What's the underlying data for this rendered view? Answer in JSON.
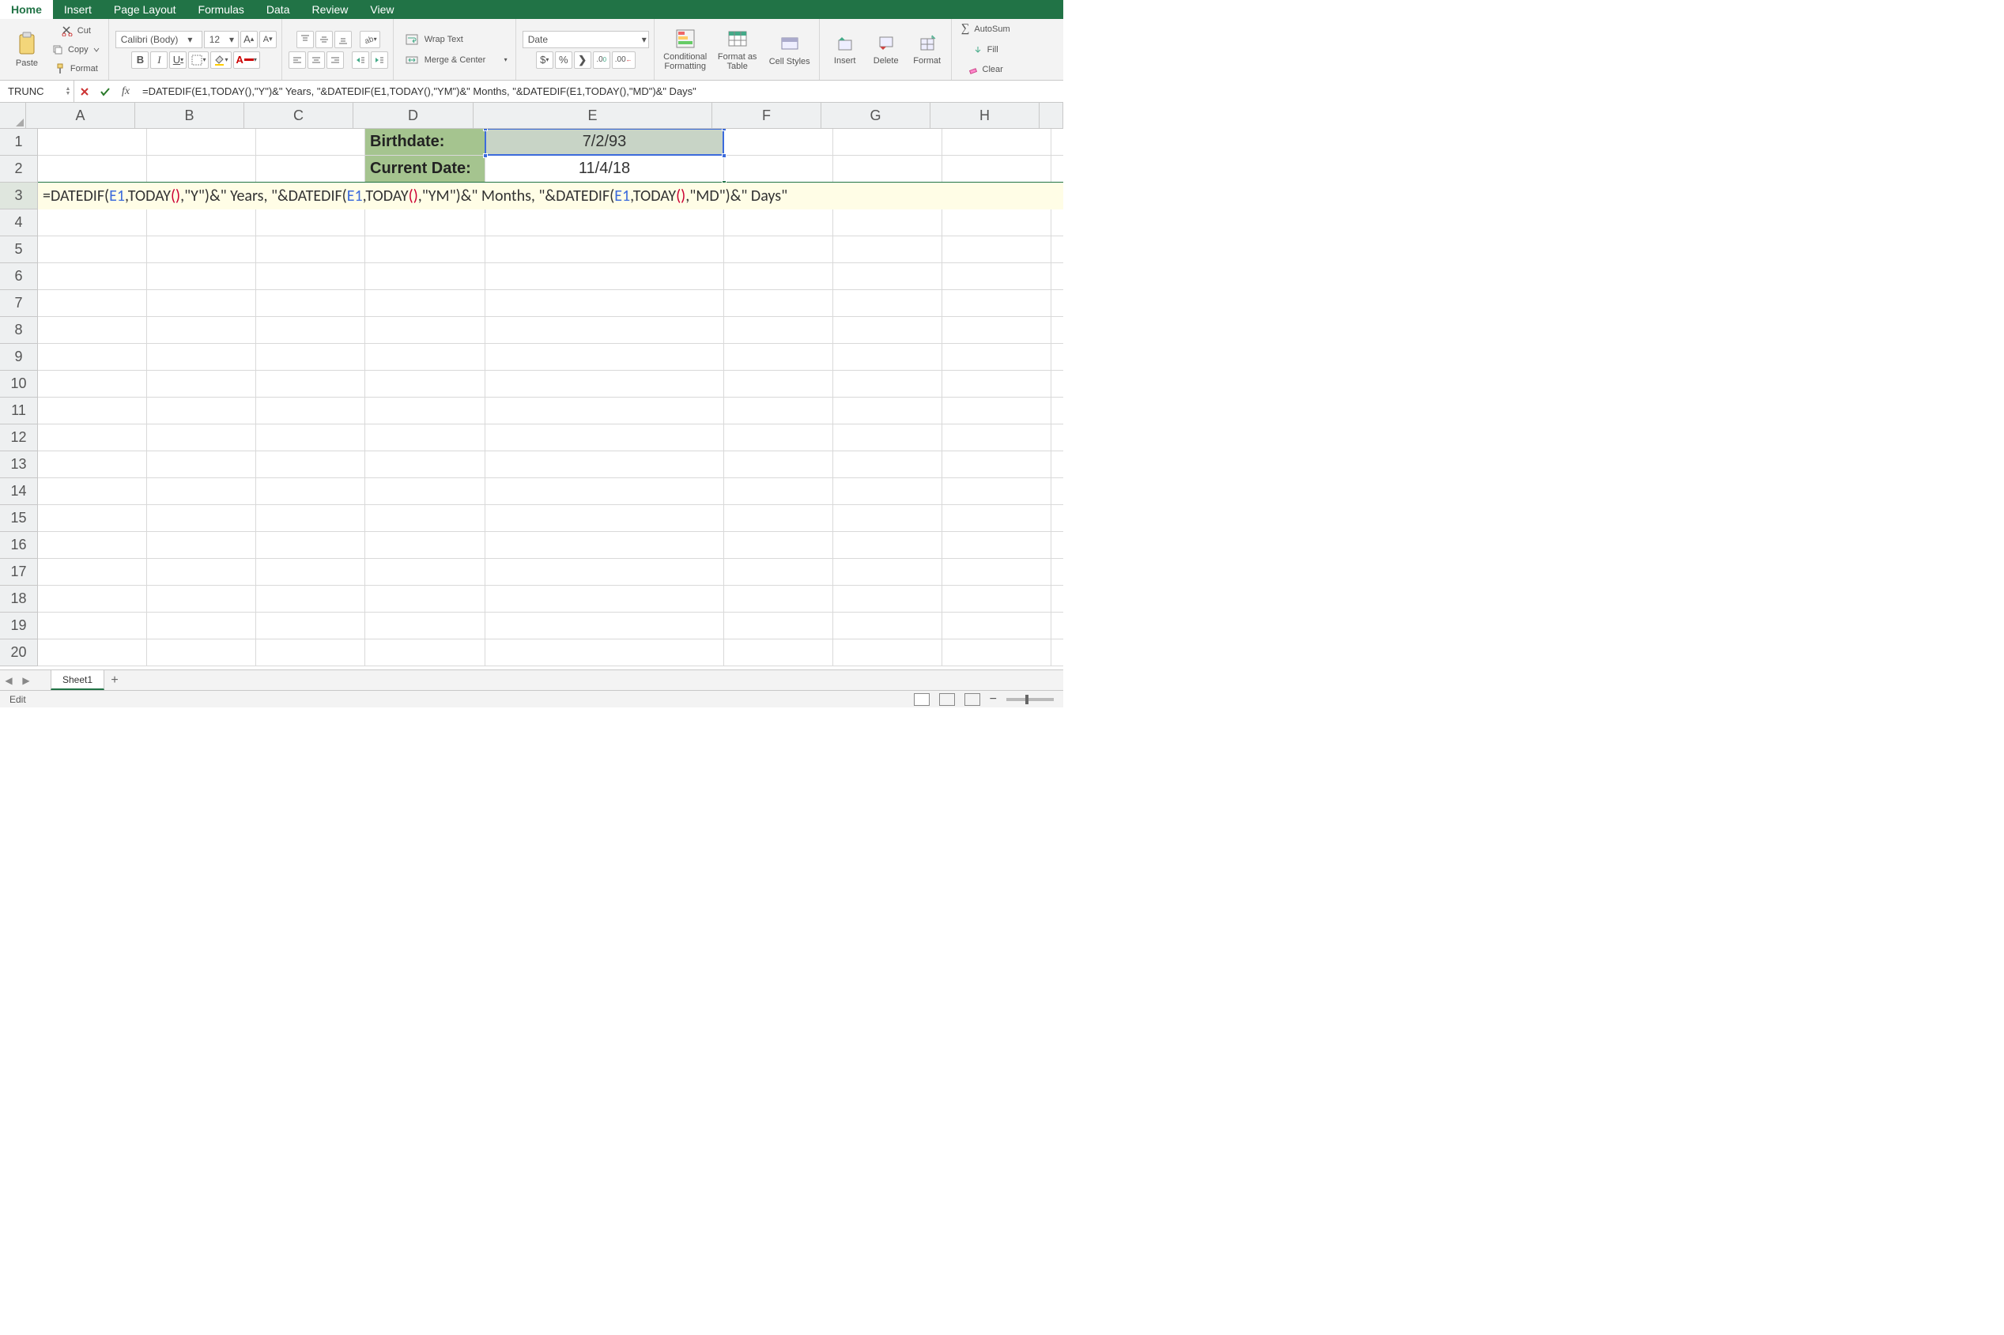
{
  "ribbon_tabs": [
    "Home",
    "Insert",
    "Page Layout",
    "Formulas",
    "Data",
    "Review",
    "View"
  ],
  "active_tab": "Home",
  "clipboard": {
    "paste": "Paste",
    "cut": "Cut",
    "copy": "Copy",
    "format": "Format"
  },
  "font": {
    "name": "Calibri (Body)",
    "size": "12"
  },
  "alignment": {
    "wrap": "Wrap Text",
    "merge": "Merge & Center"
  },
  "number_format": {
    "selected": "Date"
  },
  "styles": {
    "cond": "Conditional Formatting",
    "table": "Format as Table",
    "cell": "Cell Styles"
  },
  "cells_group": {
    "insert": "Insert",
    "delete": "Delete",
    "format": "Format"
  },
  "editing": {
    "autosum": "AutoSum",
    "fill": "Fill",
    "clear": "Clear"
  },
  "name_box": "TRUNC",
  "formula_bar": "=DATEDIF(E1,TODAY(),\"Y\")&\" Years, \"&DATEDIF(E1,TODAY(),\"YM\")&\" Months, \"&DATEDIF(E1,TODAY(),\"MD\")&\" Days\"",
  "columns": [
    "A",
    "B",
    "C",
    "D",
    "E",
    "F",
    "G",
    "H"
  ],
  "rows": [
    1,
    2,
    3,
    4,
    5,
    6,
    7,
    8,
    9,
    10,
    11,
    12,
    13,
    14,
    15,
    16,
    17,
    18,
    19,
    20
  ],
  "data": {
    "D1": "Birthdate:",
    "E1": "7/2/93",
    "D2": "Current Date:",
    "E2": "11/4/18"
  },
  "editing_cell": {
    "address": "A3",
    "formula_parts": [
      {
        "t": "=DATEDIF("
      },
      {
        "t": "E1",
        "c": "ref"
      },
      {
        "t": ",TODAY"
      },
      {
        "t": "()",
        "c": "paren"
      },
      {
        "t": ",\"Y\")&\" Years, \"&DATEDIF("
      },
      {
        "t": "E1",
        "c": "ref"
      },
      {
        "t": ",TODAY"
      },
      {
        "t": "()",
        "c": "paren"
      },
      {
        "t": ",\"YM\")&\" Months, \"&DATEDIF("
      },
      {
        "t": "E1",
        "c": "ref"
      },
      {
        "t": ",TODAY"
      },
      {
        "t": "()",
        "c": "paren"
      },
      {
        "t": ",\"MD\")&\" Days\""
      }
    ]
  },
  "selected_cell": "E1",
  "sheet_name": "Sheet1",
  "status_mode": "Edit"
}
